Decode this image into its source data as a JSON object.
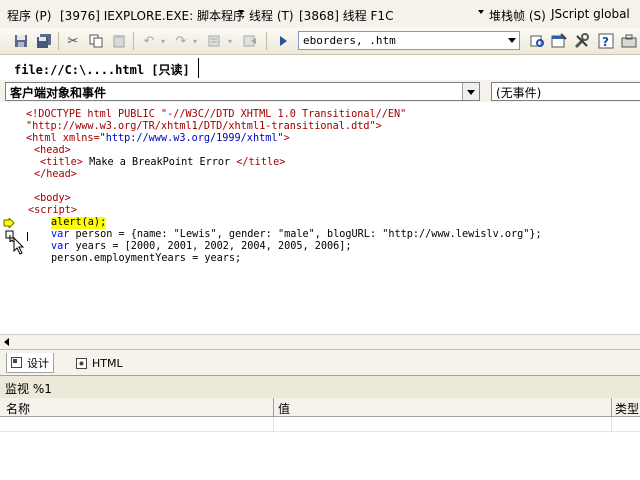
{
  "debug_bar": {
    "program_label": "程序 (P)",
    "program_value": "[3976] IEXPLORE.EXE: 脚本程序",
    "thread_label": "线程 (T)",
    "thread_value": "[3868] 线程 F1C",
    "stack_label": "堆栈帧 (S)",
    "stack_value": "JScript global"
  },
  "toolbar": {
    "config_combo": "eborders, .htm"
  },
  "document_tab": "file://C:\\....html [只读]",
  "object_dropdown": "客户端对象和事件",
  "event_dropdown": "(无事件)",
  "code": {
    "line1a": "<!DOCTYPE html PUBLIC \"-//W3C//DTD XHTML 1.0 Transitional//EN\"",
    "line1b": "\"http://www.w3.org/TR/xhtml1/DTD/xhtml1-transitional.dtd\">",
    "html_open_tag": "<html",
    "html_attr": " xmlns=",
    "html_attr_val": "\"http://www.w3.org/1999/xhtml\"",
    "html_close": ">",
    "head_open": "<head>",
    "title_open": "<title>",
    "title_text": " Make a BreakPoint Error ",
    "title_close": "</title>",
    "head_close": "</head>",
    "body_open": "<body>",
    "script_open": "<script>",
    "js1": "alert(a);",
    "js2_kw": "var",
    "js2_rest": " person = {name: \"Lewis\", gender: \"male\", blogURL: \"http://www.lewislv.org\"};",
    "js3_kw": "var",
    "js3_rest": " years = [2000, 2001, 2002, 2004, 2005, 2006];",
    "js4": "person.employmentYears = years;"
  },
  "view_tabs": {
    "design": "设计",
    "html": "HTML"
  },
  "watch": {
    "title": "监视 %1",
    "col_name": "名称",
    "col_value": "值",
    "col_type": "类型"
  },
  "colors": {
    "tag": "#a00000",
    "attr_value": "#0000c0",
    "keyword": "#0000ff",
    "current_line_arrow": "#ffff00"
  }
}
